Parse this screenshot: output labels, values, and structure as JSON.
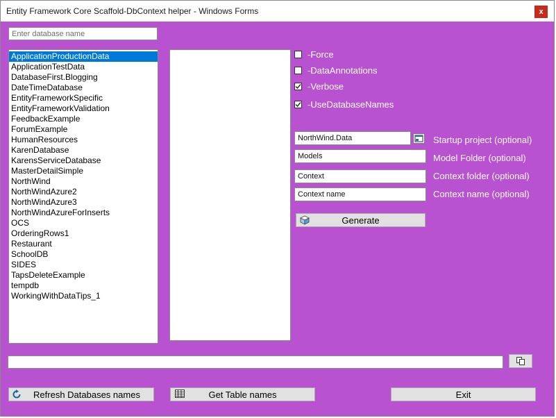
{
  "window": {
    "title": "Entity Framework Core Scaffold-DbContext helper - Windows Forms",
    "close_label": "x"
  },
  "search": {
    "placeholder": "Enter database name"
  },
  "databases": {
    "selected_index": 0,
    "items": [
      "ApplicationProductionData",
      "ApplicationTestData",
      "DatabaseFirst.Blogging",
      "DateTimeDatabase",
      "EntityFrameworkSpecific",
      "EntityFrameworkValidation",
      "FeedbackExample",
      "ForumExample",
      "HumanResources",
      "KarenDatabase",
      "KarensServiceDatabase",
      "MasterDetailSimple",
      "NorthWind",
      "NorthWindAzure2",
      "NorthWindAzure3",
      "NorthWindAzureForInserts",
      "OCS",
      "OrderingRows1",
      "Restaurant",
      "SchoolDB",
      "SIDES",
      "TapsDeleteExample",
      "tempdb",
      "WorkingWithDataTips_1"
    ]
  },
  "options": {
    "force": {
      "label": "-Force",
      "checked": false
    },
    "data_annotations": {
      "label": "-DataAnnotations",
      "checked": false
    },
    "verbose": {
      "label": "-Verbose",
      "checked": true
    },
    "use_database_names": {
      "label": "-UseDatabaseNames",
      "checked": true
    }
  },
  "fields": {
    "startup_project": {
      "value": "NorthWind.Data",
      "label": "Startup project (optional)"
    },
    "model_folder": {
      "value": "Models",
      "label": "Model Folder (optional)"
    },
    "context_folder": {
      "value": "Context",
      "label": "Context folder (optional)"
    },
    "context_name": {
      "value": "Context name",
      "label": "Context name (optional)"
    }
  },
  "buttons": {
    "generate": "Generate",
    "refresh": "Refresh Databases names",
    "get_tables": "Get Table names",
    "exit": "Exit"
  },
  "command_output": {
    "value": ""
  },
  "colors": {
    "background": "#b852d0",
    "selection": "#0078d7",
    "close": "#c42b1c"
  }
}
